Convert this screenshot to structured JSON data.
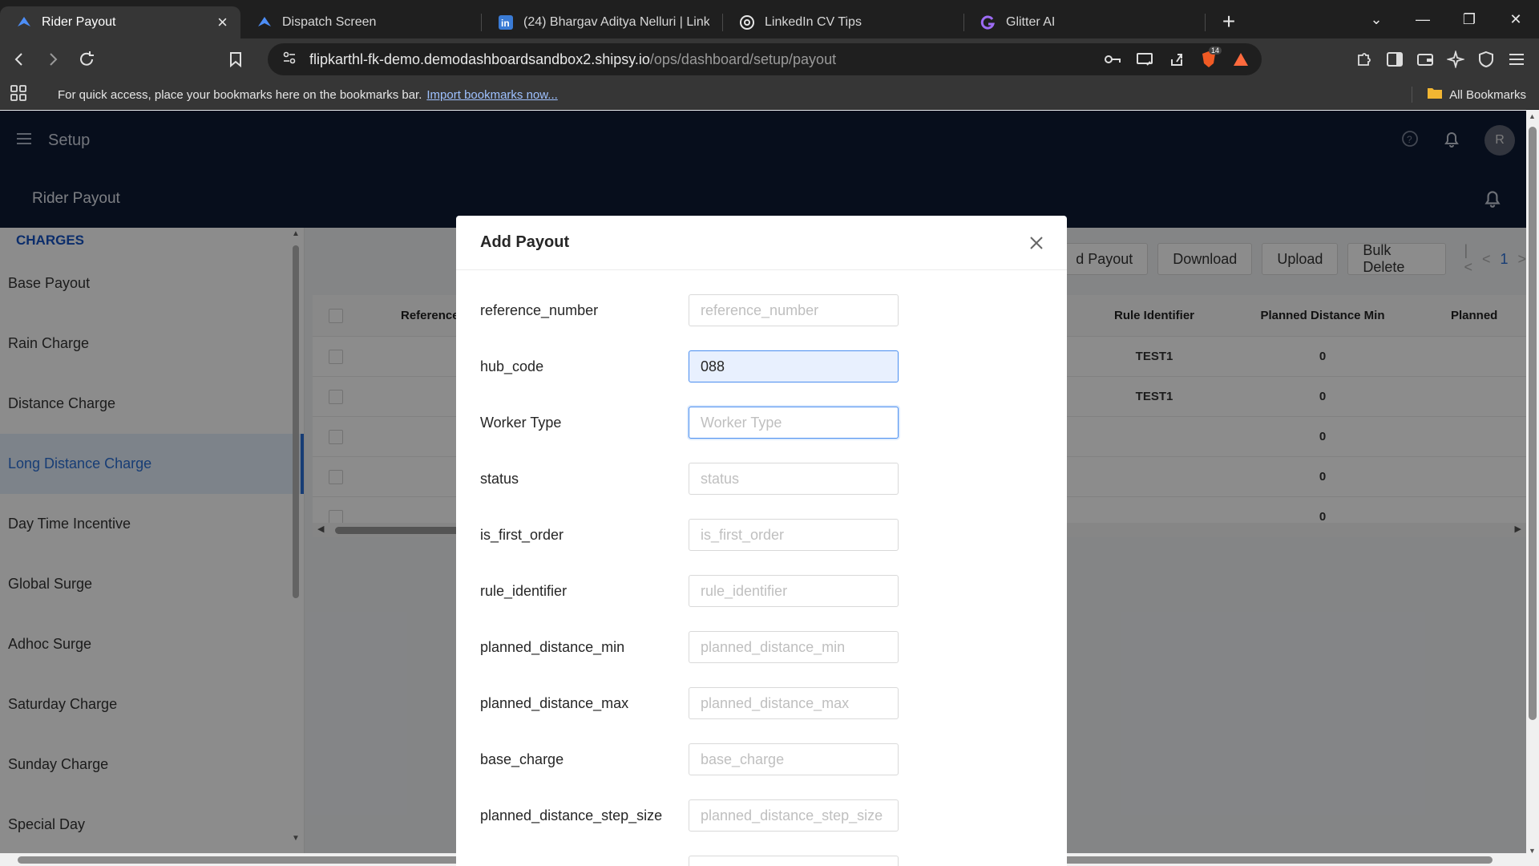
{
  "browser": {
    "tabs": [
      {
        "title": "Rider Payout",
        "active": true,
        "icon": "shipsy-icon"
      },
      {
        "title": "Dispatch Screen",
        "active": false,
        "icon": "shipsy-icon"
      },
      {
        "title": "(24) Bhargav Aditya Nelluri | LinkedIn",
        "active": false,
        "icon": "linkedin-icon"
      },
      {
        "title": "LinkedIn CV Tips",
        "active": false,
        "icon": "chatgpt-icon"
      },
      {
        "title": "Glitter AI",
        "active": false,
        "icon": "glitter-icon"
      }
    ],
    "url_host": "flipkarthl-fk-demo.demodashboardsandbox2.shipsy.io",
    "url_path": "/ops/dashboard/setup/payout",
    "brave_badge": "14",
    "bookmarks_text": "For quick access, place your bookmarks here on the bookmarks bar.",
    "bookmarks_link": "Import bookmarks now...",
    "all_bookmarks": "All Bookmarks"
  },
  "app": {
    "header_title": "Setup",
    "avatar_initial": "R",
    "sub_title": "Rider Payout"
  },
  "sidebar": {
    "heading": "CHARGES",
    "items": [
      {
        "label": "Base Payout"
      },
      {
        "label": "Rain Charge"
      },
      {
        "label": "Distance Charge"
      },
      {
        "label": "Long Distance Charge",
        "active": true
      },
      {
        "label": "Day Time Incentive"
      },
      {
        "label": "Global Surge"
      },
      {
        "label": "Adhoc Surge"
      },
      {
        "label": "Saturday Charge"
      },
      {
        "label": "Sunday Charge"
      },
      {
        "label": "Special Day"
      }
    ]
  },
  "actions": {
    "add_label": "Add Payout",
    "add_visible_fragment": "d Payout",
    "download_label": "Download",
    "upload_label": "Upload",
    "bulk_delete_label": "Bulk Delete",
    "page_number": "1"
  },
  "table": {
    "columns": [
      "Reference",
      "Rule Identifier",
      "Planned Distance Min",
      "Planned"
    ],
    "rows": [
      {
        "rule_identifier": "TEST1",
        "planned_distance_min": "0"
      },
      {
        "rule_identifier": "TEST1",
        "planned_distance_min": "0"
      },
      {
        "rule_identifier": "",
        "planned_distance_min": "0"
      },
      {
        "rule_identifier": "",
        "planned_distance_min": "0"
      },
      {
        "rule_identifier": "",
        "planned_distance_min": "0"
      }
    ]
  },
  "modal": {
    "title": "Add Payout",
    "fields": [
      {
        "label": "reference_number",
        "placeholder": "reference_number",
        "value": ""
      },
      {
        "label": "hub_code",
        "placeholder": "hub_code",
        "value": "088"
      },
      {
        "label": "Worker Type",
        "placeholder": "Worker Type",
        "value": ""
      },
      {
        "label": "status",
        "placeholder": "status",
        "value": ""
      },
      {
        "label": "is_first_order",
        "placeholder": "is_first_order",
        "value": ""
      },
      {
        "label": "rule_identifier",
        "placeholder": "rule_identifier",
        "value": ""
      },
      {
        "label": "planned_distance_min",
        "placeholder": "planned_distance_min",
        "value": ""
      },
      {
        "label": "planned_distance_max",
        "placeholder": "planned_distance_max",
        "value": ""
      },
      {
        "label": "base_charge",
        "placeholder": "base_charge",
        "value": ""
      },
      {
        "label": "planned_distance_step_size",
        "placeholder": "planned_distance_step_size",
        "value": ""
      }
    ]
  },
  "colors": {
    "app_header": "#0e1a33",
    "accent": "#2a6fd6",
    "overlay": "rgba(0,0,0,0.45)"
  }
}
